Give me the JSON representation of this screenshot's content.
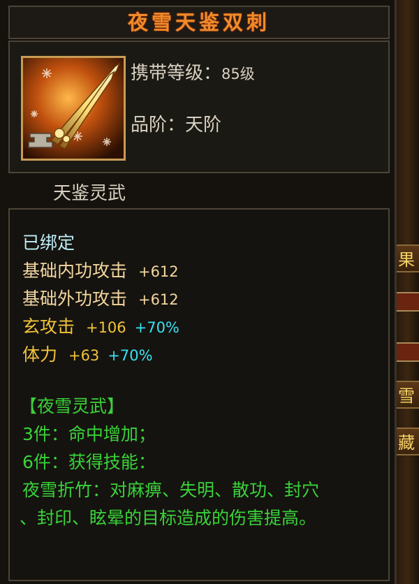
{
  "item": {
    "name": "夜雪天鉴双刺",
    "level_label": "携带等级：",
    "level_value": "85级",
    "grade_label": "品阶：",
    "grade_value": "天阶",
    "category": "天鉴灵武"
  },
  "stats": {
    "bound": "已绑定",
    "inner_attack_label": "基础内功攻击",
    "inner_attack_value": "+612",
    "outer_attack_label": "基础外功攻击",
    "outer_attack_value": "+612",
    "xuan_attack_label": "玄攻击",
    "xuan_attack_value": "+106",
    "xuan_attack_bonus": "+70%",
    "stamina_label": "体力",
    "stamina_value": "+63",
    "stamina_bonus": "+70%"
  },
  "set": {
    "name": "【夜雪灵武】",
    "bonus3": "3件：命中增加；",
    "bonus6": "6件：获得技能：",
    "skill_line1": "夜雪折竹：对麻痹、失明、散功、封穴",
    "skill_line2": "、封印、眩晕的目标造成的伤害提高。"
  },
  "background_tabs": [
    "果",
    "雪技",
    "藏"
  ],
  "icons": {
    "item_icon": "twin-blade-icon",
    "bind_badge": "anvil-icon"
  },
  "colors": {
    "title": "#f08a2a",
    "text": "#d8d0c0",
    "bound": "#bfeef6",
    "base_stat": "#f4d7a0",
    "gold_stat": "#f2c43a",
    "bonus": "#37e2f4",
    "set": "#39d23a",
    "border": "#4c4436"
  }
}
